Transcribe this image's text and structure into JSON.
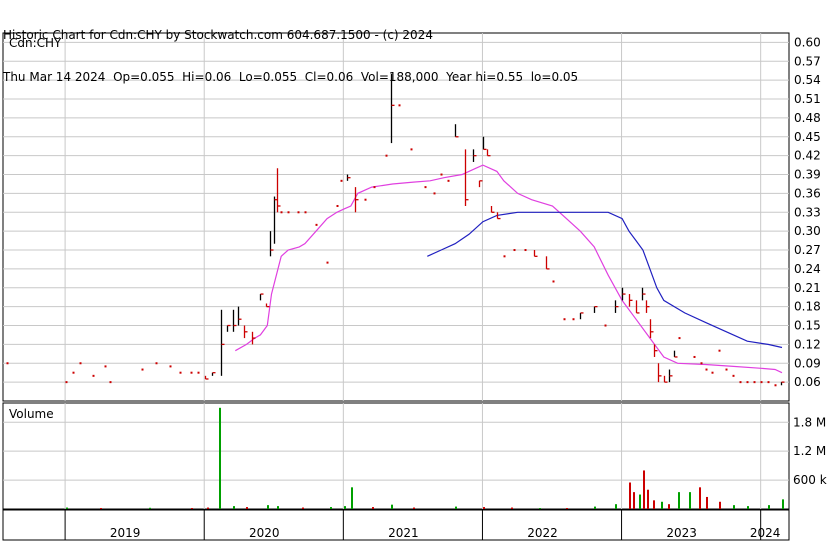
{
  "header": {
    "line1": "Historic Chart for Cdn:CHY by Stockwatch.com 604.687.1500 - (c) 2024",
    "line2": "Thu Mar 14 2024  Op=0.055  Hi=0.06  Lo=0.055  Cl=0.06  Vol=188,000  Year hi=0.55  lo=0.05"
  },
  "colors": {
    "up": "#cc0000",
    "down": "#000000",
    "ma_short": "#e040e0",
    "ma_long": "#2020c0",
    "volume_up": "#00a000",
    "volume_down": "#cc0000",
    "grid": "#c8c8c8"
  },
  "chart_data": [
    {
      "type": "line",
      "panel": "price",
      "symbol_label": "Cdn:CHY",
      "y_ticks": [
        "0.60",
        "0.57",
        "0.54",
        "0.51",
        "0.48",
        "0.45",
        "0.42",
        "0.39",
        "0.36",
        "0.33",
        "0.30",
        "0.27",
        "0.24",
        "0.21",
        "0.18",
        "0.15",
        "0.12",
        "0.09",
        "0.06"
      ],
      "ylim": [
        0.03,
        0.615
      ],
      "xlim": [
        2018.55,
        2024.2
      ],
      "x_tick_labels": [
        "2019",
        "2020",
        "2021",
        "2022",
        "2023",
        "2024"
      ],
      "x_year_starts": [
        2019,
        2020,
        2021,
        2022,
        2023,
        2024
      ],
      "grid": true,
      "series": [
        {
          "style": "hlc_bars",
          "points": [
            [
              2018.58,
              0.09,
              0.09,
              0.09
            ],
            [
              2019.0,
              0.06,
              0.06,
              0.06
            ],
            [
              2019.05,
              0.075,
              0.075,
              0.075
            ],
            [
              2019.1,
              0.09,
              0.09,
              0.09
            ],
            [
              2019.2,
              0.07,
              0.07,
              0.07
            ],
            [
              2019.28,
              0.085,
              0.085,
              0.085
            ],
            [
              2019.32,
              0.06,
              0.06,
              0.06
            ],
            [
              2019.55,
              0.08,
              0.08,
              0.08
            ],
            [
              2019.65,
              0.09,
              0.09,
              0.09
            ],
            [
              2019.75,
              0.085,
              0.085,
              0.085
            ],
            [
              2019.82,
              0.075,
              0.075,
              0.075
            ],
            [
              2019.9,
              0.075,
              0.075,
              0.075
            ],
            [
              2019.95,
              0.075,
              0.075,
              0.075
            ],
            [
              2020.0,
              0.07,
              0.065,
              0.065
            ],
            [
              2020.05,
              0.075,
              0.07,
              0.075
            ],
            [
              2020.12,
              0.175,
              0.07,
              0.12
            ],
            [
              2020.16,
              0.15,
              0.14,
              0.15
            ],
            [
              2020.2,
              0.175,
              0.14,
              0.15
            ],
            [
              2020.24,
              0.18,
              0.15,
              0.16
            ],
            [
              2020.28,
              0.15,
              0.13,
              0.14
            ],
            [
              2020.34,
              0.14,
              0.12,
              0.13
            ],
            [
              2020.4,
              0.2,
              0.19,
              0.2
            ],
            [
              2020.44,
              0.185,
              0.18,
              0.18
            ],
            [
              2020.47,
              0.3,
              0.26,
              0.27
            ],
            [
              2020.5,
              0.355,
              0.28,
              0.35
            ],
            [
              2020.52,
              0.4,
              0.33,
              0.34
            ],
            [
              2020.55,
              0.33,
              0.33,
              0.33
            ],
            [
              2020.6,
              0.33,
              0.33,
              0.33
            ],
            [
              2020.67,
              0.33,
              0.33,
              0.33
            ],
            [
              2020.72,
              0.33,
              0.33,
              0.33
            ],
            [
              2020.8,
              0.31,
              0.31,
              0.31
            ],
            [
              2020.88,
              0.25,
              0.25,
              0.25
            ],
            [
              2020.95,
              0.34,
              0.34,
              0.34
            ],
            [
              2020.98,
              0.38,
              0.38,
              0.38
            ],
            [
              2021.02,
              0.39,
              0.38,
              0.385
            ],
            [
              2021.08,
              0.37,
              0.33,
              0.35
            ],
            [
              2021.15,
              0.35,
              0.35,
              0.35
            ],
            [
              2021.22,
              0.37,
              0.37,
              0.37
            ],
            [
              2021.3,
              0.42,
              0.42,
              0.42
            ],
            [
              2021.34,
              0.55,
              0.44,
              0.5
            ],
            [
              2021.4,
              0.5,
              0.5,
              0.5
            ],
            [
              2021.48,
              0.43,
              0.43,
              0.43
            ],
            [
              2021.58,
              0.37,
              0.37,
              0.37
            ],
            [
              2021.65,
              0.36,
              0.36,
              0.36
            ],
            [
              2021.7,
              0.39,
              0.39,
              0.39
            ],
            [
              2021.75,
              0.38,
              0.38,
              0.38
            ],
            [
              2021.8,
              0.47,
              0.45,
              0.45
            ],
            [
              2021.87,
              0.43,
              0.34,
              0.35
            ],
            [
              2021.93,
              0.43,
              0.41,
              0.42
            ],
            [
              2021.97,
              0.38,
              0.37,
              0.38
            ],
            [
              2022.0,
              0.45,
              0.43,
              0.43
            ],
            [
              2022.03,
              0.43,
              0.42,
              0.42
            ],
            [
              2022.06,
              0.34,
              0.33,
              0.33
            ],
            [
              2022.1,
              0.33,
              0.32,
              0.32
            ],
            [
              2022.15,
              0.26,
              0.26,
              0.26
            ],
            [
              2022.22,
              0.27,
              0.27,
              0.27
            ],
            [
              2022.3,
              0.27,
              0.27,
              0.27
            ],
            [
              2022.37,
              0.27,
              0.26,
              0.26
            ],
            [
              2022.45,
              0.26,
              0.24,
              0.24
            ],
            [
              2022.5,
              0.22,
              0.22,
              0.22
            ],
            [
              2022.58,
              0.16,
              0.16,
              0.16
            ],
            [
              2022.65,
              0.16,
              0.16,
              0.16
            ],
            [
              2022.7,
              0.17,
              0.16,
              0.17
            ],
            [
              2022.8,
              0.18,
              0.17,
              0.18
            ],
            [
              2022.88,
              0.15,
              0.15,
              0.15
            ],
            [
              2022.95,
              0.19,
              0.17,
              0.18
            ],
            [
              2023.0,
              0.21,
              0.19,
              0.2
            ],
            [
              2023.05,
              0.2,
              0.18,
              0.19
            ],
            [
              2023.1,
              0.19,
              0.17,
              0.17
            ],
            [
              2023.14,
              0.21,
              0.19,
              0.2
            ],
            [
              2023.17,
              0.19,
              0.17,
              0.18
            ],
            [
              2023.2,
              0.16,
              0.13,
              0.14
            ],
            [
              2023.23,
              0.12,
              0.1,
              0.11
            ],
            [
              2023.26,
              0.09,
              0.06,
              0.07
            ],
            [
              2023.3,
              0.07,
              0.06,
              0.06
            ],
            [
              2023.34,
              0.08,
              0.06,
              0.07
            ],
            [
              2023.37,
              0.11,
              0.1,
              0.1
            ],
            [
              2023.41,
              0.13,
              0.13,
              0.13
            ],
            [
              2023.52,
              0.1,
              0.1,
              0.1
            ],
            [
              2023.57,
              0.09,
              0.09,
              0.09
            ],
            [
              2023.6,
              0.08,
              0.08,
              0.08
            ],
            [
              2023.65,
              0.075,
              0.075,
              0.075
            ],
            [
              2023.7,
              0.11,
              0.11,
              0.11
            ],
            [
              2023.75,
              0.08,
              0.08,
              0.08
            ],
            [
              2023.8,
              0.07,
              0.07,
              0.07
            ],
            [
              2023.85,
              0.06,
              0.06,
              0.06
            ],
            [
              2023.9,
              0.06,
              0.06,
              0.06
            ],
            [
              2023.95,
              0.06,
              0.06,
              0.06
            ],
            [
              2024.0,
              0.06,
              0.06,
              0.06
            ],
            [
              2024.05,
              0.06,
              0.06,
              0.06
            ],
            [
              2024.1,
              0.055,
              0.055,
              0.055
            ],
            [
              2024.14,
              0.06,
              0.055,
              0.06
            ]
          ]
        },
        {
          "style": "line",
          "color_key": "ma_short",
          "x": [
            2020.22,
            2020.3,
            2020.36,
            2020.4,
            2020.45,
            2020.48,
            2020.55,
            2020.6,
            2020.68,
            2020.72,
            2020.8,
            2020.88,
            2020.95,
            2021.0,
            2021.05,
            2021.1,
            2021.2,
            2021.35,
            2021.5,
            2021.62,
            2021.72,
            2021.85,
            2021.95,
            2022.0,
            2022.1,
            2022.15,
            2022.25,
            2022.35,
            2022.5,
            2022.6,
            2022.7,
            2022.8,
            2022.9,
            2023.0,
            2023.1,
            2023.2,
            2023.3,
            2023.4,
            2023.6,
            2023.8,
            2024.0,
            2024.1,
            2024.15
          ],
          "y": [
            0.11,
            0.12,
            0.13,
            0.135,
            0.15,
            0.2,
            0.26,
            0.27,
            0.275,
            0.28,
            0.3,
            0.32,
            0.33,
            0.335,
            0.34,
            0.36,
            0.37,
            0.375,
            0.378,
            0.38,
            0.385,
            0.39,
            0.4,
            0.405,
            0.395,
            0.38,
            0.36,
            0.35,
            0.34,
            0.32,
            0.3,
            0.275,
            0.23,
            0.19,
            0.16,
            0.13,
            0.1,
            0.09,
            0.088,
            0.085,
            0.082,
            0.08,
            0.075
          ]
        },
        {
          "style": "line",
          "color_key": "ma_long",
          "x": [
            2021.6,
            2021.7,
            2021.8,
            2021.9,
            2022.0,
            2022.1,
            2022.25,
            2022.4,
            2022.5,
            2022.6,
            2022.7,
            2022.8,
            2022.9,
            2023.0,
            2023.05,
            2023.1,
            2023.15,
            2023.2,
            2023.25,
            2023.3,
            2023.45,
            2023.6,
            2023.75,
            2023.9,
            2024.05,
            2024.15
          ],
          "y": [
            0.26,
            0.27,
            0.28,
            0.295,
            0.315,
            0.325,
            0.33,
            0.33,
            0.33,
            0.33,
            0.33,
            0.33,
            0.33,
            0.32,
            0.3,
            0.285,
            0.27,
            0.24,
            0.21,
            0.19,
            0.17,
            0.155,
            0.14,
            0.125,
            0.12,
            0.115
          ]
        }
      ]
    },
    {
      "type": "bar",
      "panel": "volume",
      "title": "Volume",
      "y_ticks": [
        "1.8 M",
        "1.2 M",
        "600 k"
      ],
      "ylim": [
        0,
        2200000
      ],
      "xlim": [
        2018.55,
        2024.2
      ],
      "grid": true,
      "bars": [
        [
          2019.0,
          30000,
          "u"
        ],
        [
          2019.25,
          20000,
          "d"
        ],
        [
          2019.6,
          25000,
          "u"
        ],
        [
          2019.9,
          20000,
          "d"
        ],
        [
          2020.02,
          30000,
          "d"
        ],
        [
          2020.1,
          2100000,
          "u"
        ],
        [
          2020.2,
          60000,
          "u"
        ],
        [
          2020.3,
          40000,
          "d"
        ],
        [
          2020.45,
          80000,
          "u"
        ],
        [
          2020.52,
          60000,
          "u"
        ],
        [
          2020.7,
          30000,
          "d"
        ],
        [
          2020.9,
          40000,
          "u"
        ],
        [
          2021.0,
          60000,
          "u"
        ],
        [
          2021.05,
          450000,
          "u"
        ],
        [
          2021.2,
          40000,
          "d"
        ],
        [
          2021.34,
          90000,
          "u"
        ],
        [
          2021.5,
          30000,
          "d"
        ],
        [
          2021.8,
          50000,
          "u"
        ],
        [
          2022.0,
          40000,
          "d"
        ],
        [
          2022.2,
          30000,
          "d"
        ],
        [
          2022.4,
          20000,
          "u"
        ],
        [
          2022.6,
          20000,
          "d"
        ],
        [
          2022.8,
          50000,
          "u"
        ],
        [
          2022.95,
          100000,
          "u"
        ],
        [
          2023.05,
          550000,
          "d"
        ],
        [
          2023.08,
          350000,
          "d"
        ],
        [
          2023.12,
          300000,
          "u"
        ],
        [
          2023.15,
          800000,
          "d"
        ],
        [
          2023.18,
          400000,
          "d"
        ],
        [
          2023.22,
          180000,
          "d"
        ],
        [
          2023.28,
          150000,
          "u"
        ],
        [
          2023.33,
          100000,
          "d"
        ],
        [
          2023.4,
          350000,
          "u"
        ],
        [
          2023.48,
          350000,
          "u"
        ],
        [
          2023.55,
          450000,
          "d"
        ],
        [
          2023.6,
          250000,
          "d"
        ],
        [
          2023.7,
          150000,
          "d"
        ],
        [
          2023.8,
          80000,
          "u"
        ],
        [
          2023.9,
          60000,
          "u"
        ],
        [
          2024.05,
          80000,
          "u"
        ],
        [
          2024.15,
          200000,
          "u"
        ]
      ]
    }
  ]
}
